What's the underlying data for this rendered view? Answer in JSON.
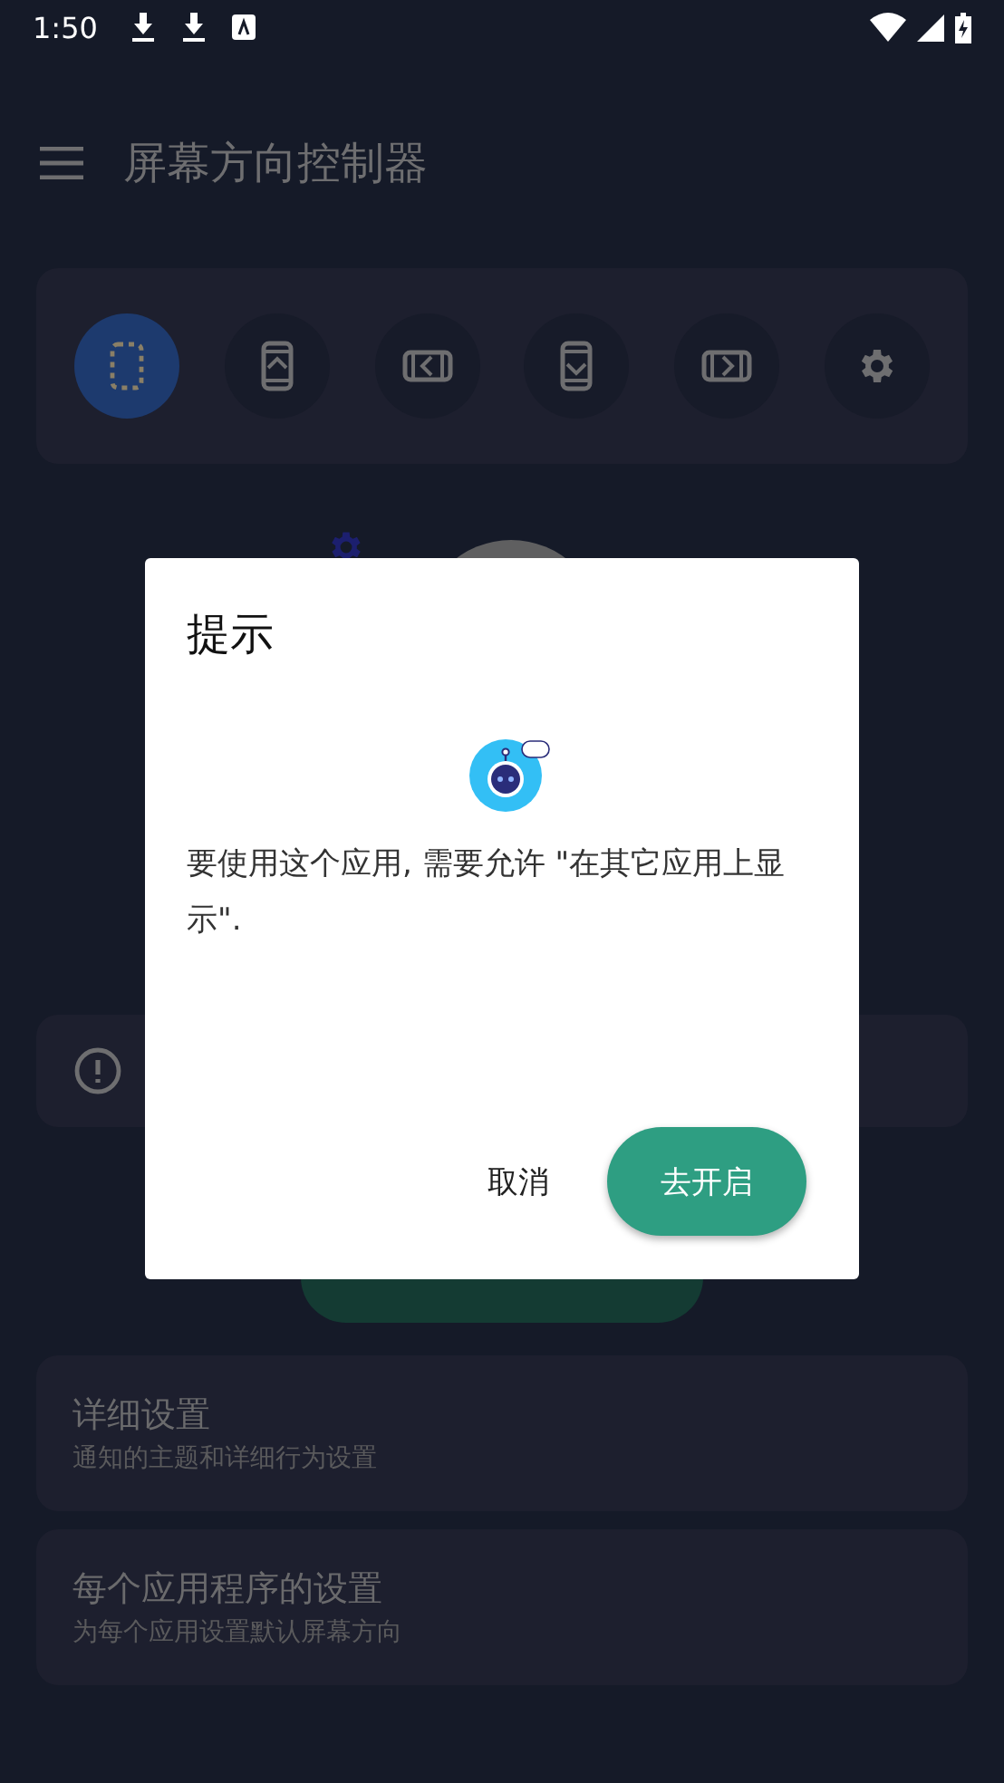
{
  "status_bar": {
    "time": "1:50"
  },
  "app_bar": {
    "title": "屏幕方向控制器"
  },
  "orientation_modes": [
    {
      "kind": "auto",
      "selected": true
    },
    {
      "kind": "portrait",
      "selected": false
    },
    {
      "kind": "landscape",
      "selected": false
    },
    {
      "kind": "reverse_portrait",
      "selected": false
    },
    {
      "kind": "reverse_landscape",
      "selected": false
    },
    {
      "kind": "settings",
      "selected": false
    }
  ],
  "settings": [
    {
      "title": "详细设置",
      "subtitle": "通知的主题和详细行为设置"
    },
    {
      "title": "每个应用程序的设置",
      "subtitle": "为每个应用设置默认屏幕方向"
    }
  ],
  "dialog": {
    "title": "提示",
    "message": "要使用这个应用, 需要允许 \"在其它应用上显示\".",
    "buttons": [
      {
        "label": "取消",
        "kind": "text"
      },
      {
        "label": "去开启",
        "kind": "filled"
      }
    ]
  }
}
